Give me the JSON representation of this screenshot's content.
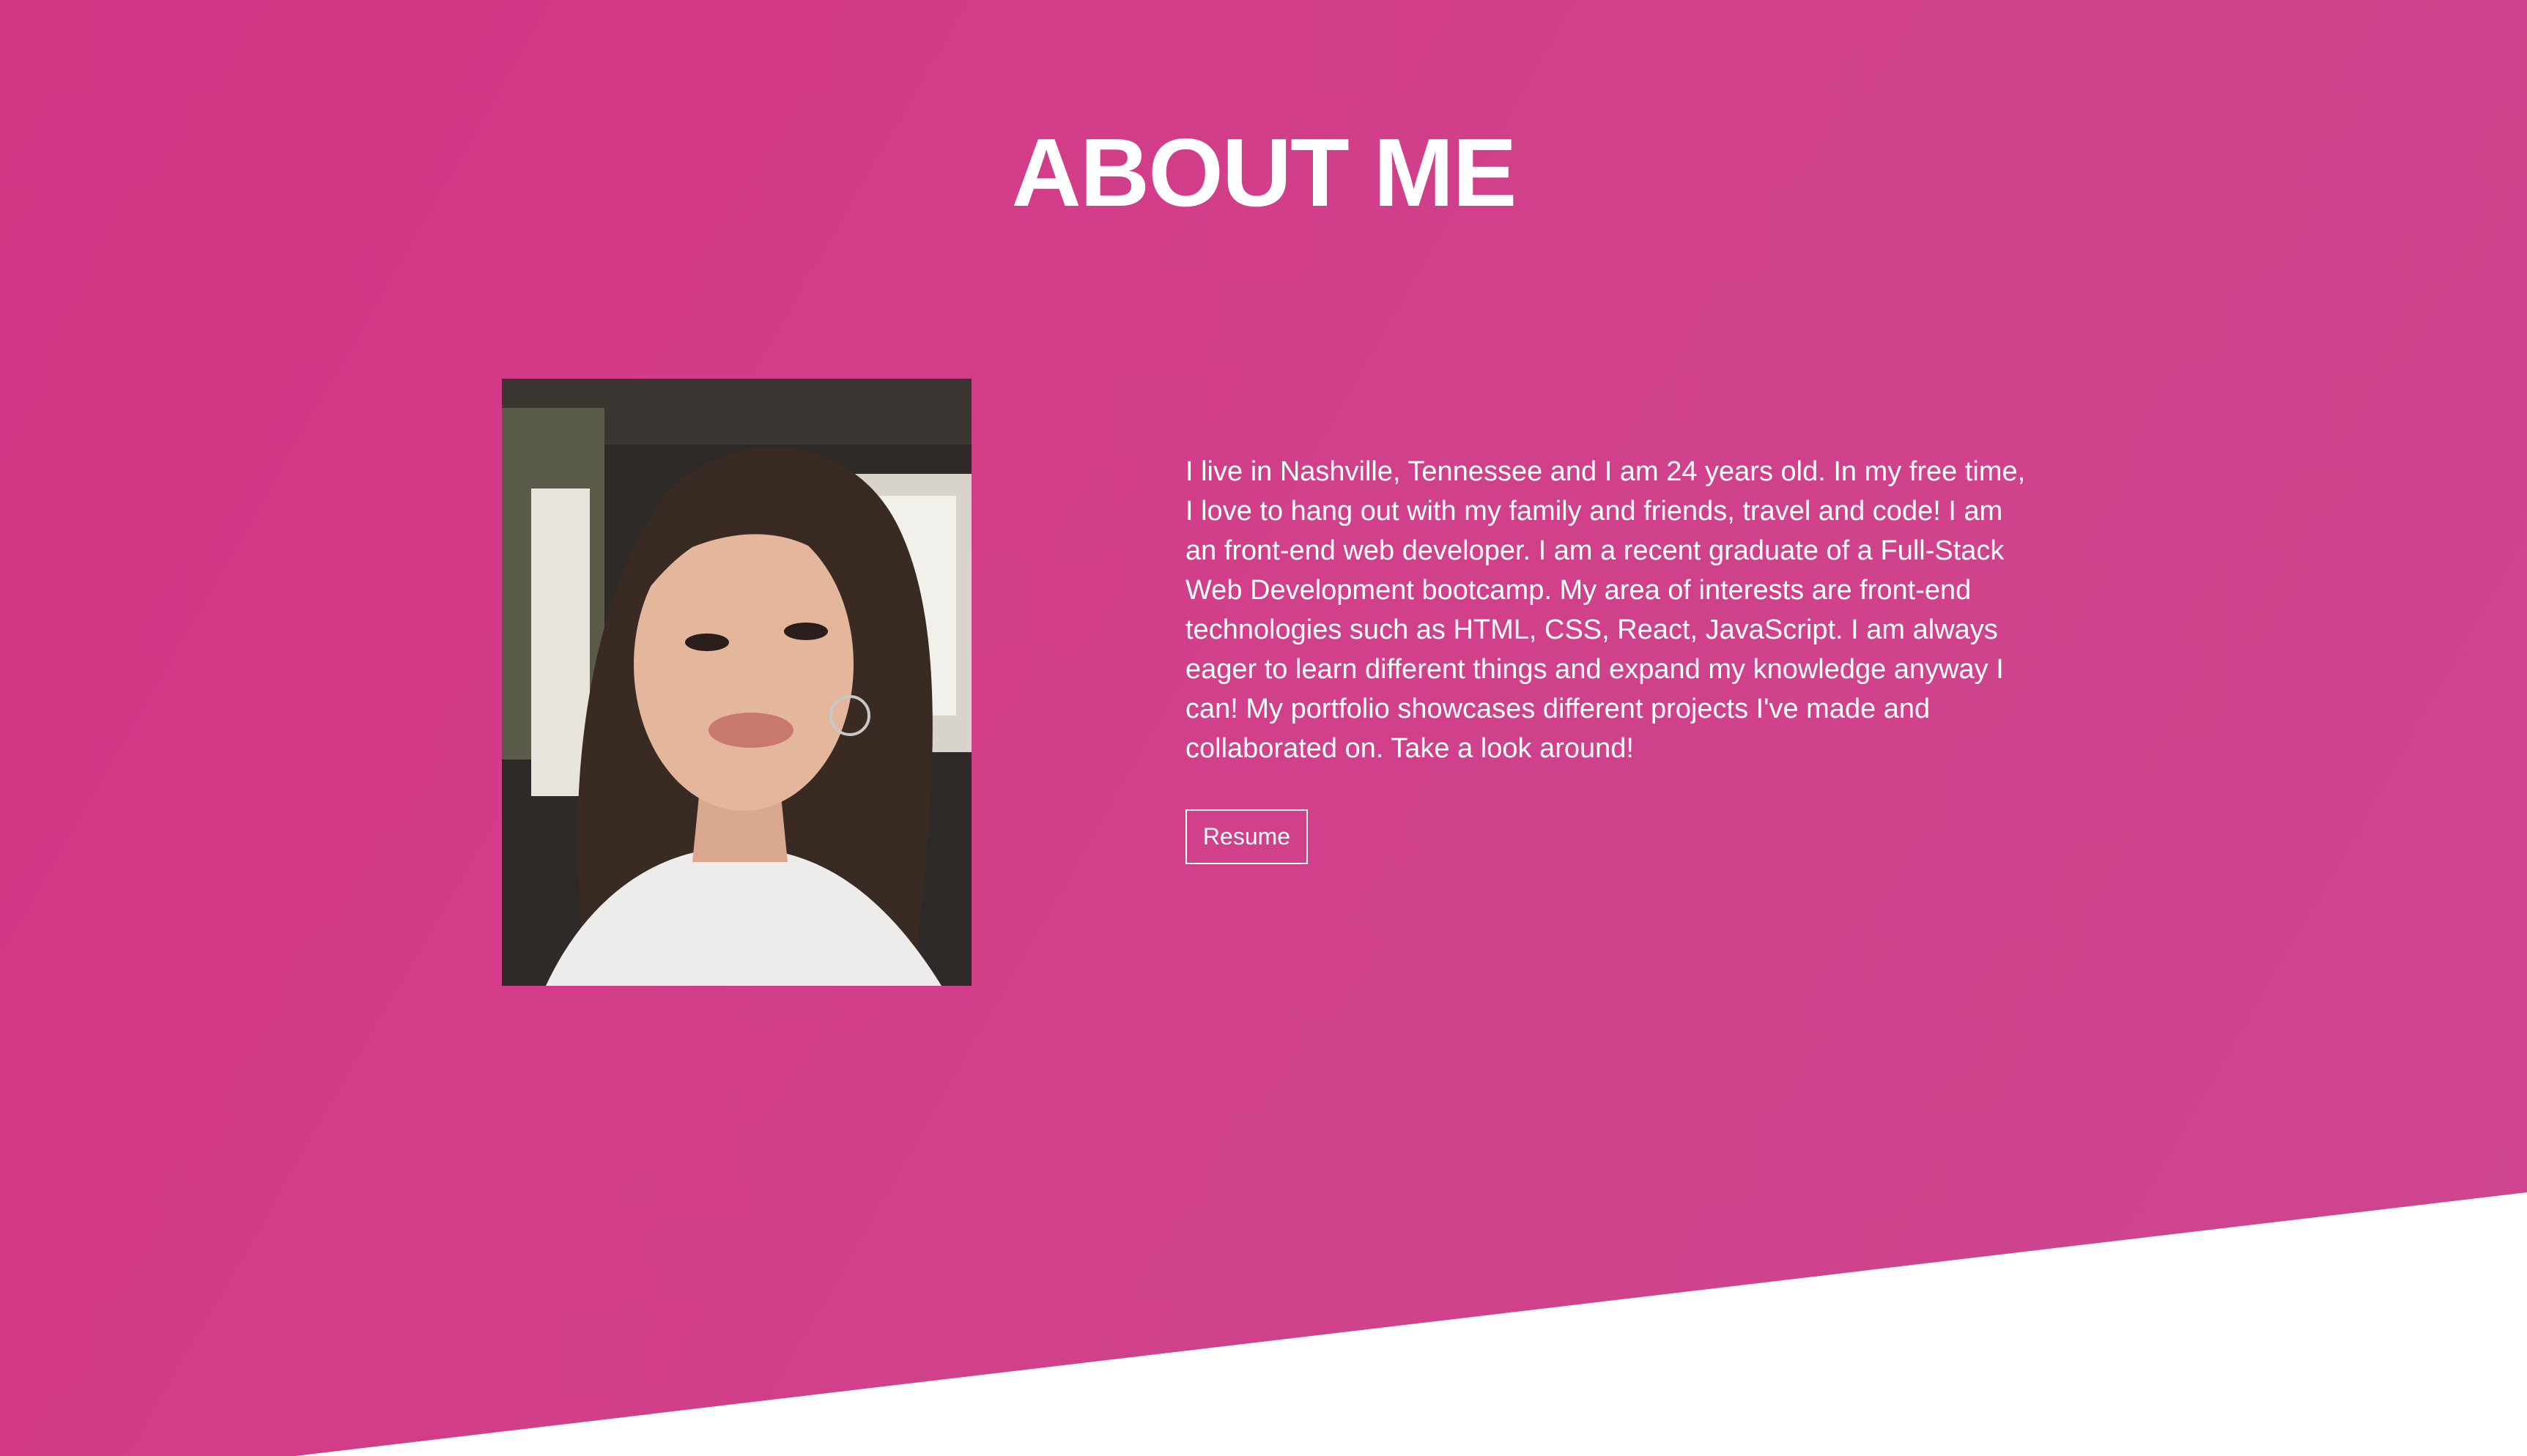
{
  "about": {
    "title": "ABOUT ME",
    "bio": "I live in Nashville, Tennessee and I am 24 years old. In my free time, I love to hang out with my family and friends, travel and code! I am an front-end web developer. I am a recent graduate of a Full-Stack Web Development bootcamp. My area of interests are front-end technologies such as HTML, CSS, React, JavaScript. I am always eager to learn different things and expand my knowledge anyway I can! My portfolio showcases different projects I've made and collaborated on. Take a look around!",
    "resume_label": "Resume"
  },
  "colors": {
    "background_pink": "#d1408a",
    "text": "#ffffff",
    "page_white": "#ffffff"
  }
}
